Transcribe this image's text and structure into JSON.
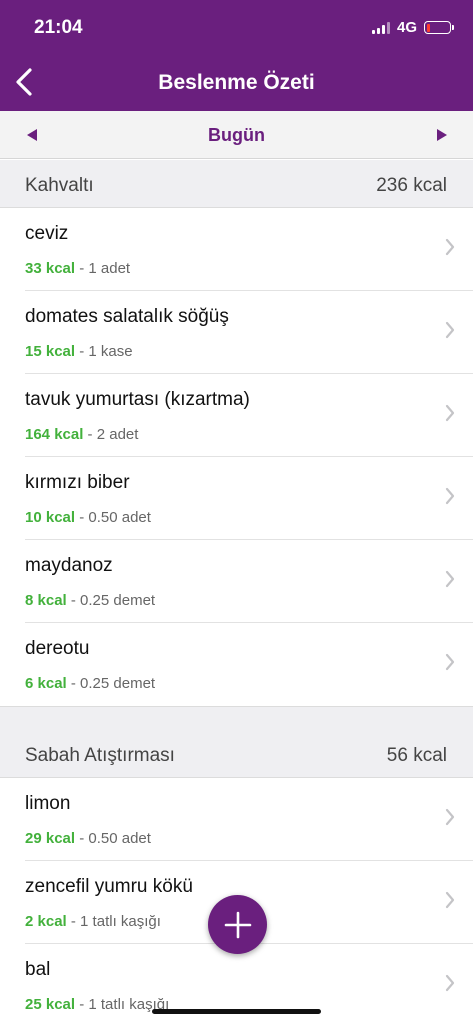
{
  "status_bar": {
    "time": "21:04",
    "network": "4G",
    "battery_level": 0.15
  },
  "nav": {
    "title": "Beslenme Özeti"
  },
  "date_bar": {
    "label": "Bugün"
  },
  "sections": [
    {
      "title": "Kahvaltı",
      "total": "236 kcal",
      "items": [
        {
          "name": "ceviz",
          "kcal": "33 kcal",
          "portion": " - 1 adet"
        },
        {
          "name": "domates salatalık söğüş",
          "kcal": "15 kcal",
          "portion": " - 1 kase"
        },
        {
          "name": "tavuk yumurtası (kızartma)",
          "kcal": "164 kcal",
          "portion": " - 2 adet"
        },
        {
          "name": "kırmızı biber",
          "kcal": "10 kcal",
          "portion": " - 0.50 adet"
        },
        {
          "name": "maydanoz",
          "kcal": "8 kcal",
          "portion": " - 0.25 demet"
        },
        {
          "name": "dereotu",
          "kcal": "6 kcal",
          "portion": " - 0.25 demet"
        }
      ]
    },
    {
      "title": "Sabah Atıştırması",
      "total": "56 kcal",
      "items": [
        {
          "name": "limon",
          "kcal": "29 kcal",
          "portion": " - 0.50 adet"
        },
        {
          "name": "zencefil yumru kökü",
          "kcal": "2 kcal",
          "portion": " - 1 tatlı kaşığı"
        },
        {
          "name": "bal",
          "kcal": "25 kcal",
          "portion": " - 1 tatlı kaşığı"
        }
      ]
    }
  ],
  "icons": {
    "back": "chevron-left-icon",
    "prev": "triangle-left-icon",
    "next": "triangle-right-icon",
    "row": "chevron-right-icon",
    "add": "plus-icon"
  },
  "colors": {
    "brand": "#6a1f7e",
    "kcal": "#43b13c",
    "section_bg": "#efeff2"
  }
}
